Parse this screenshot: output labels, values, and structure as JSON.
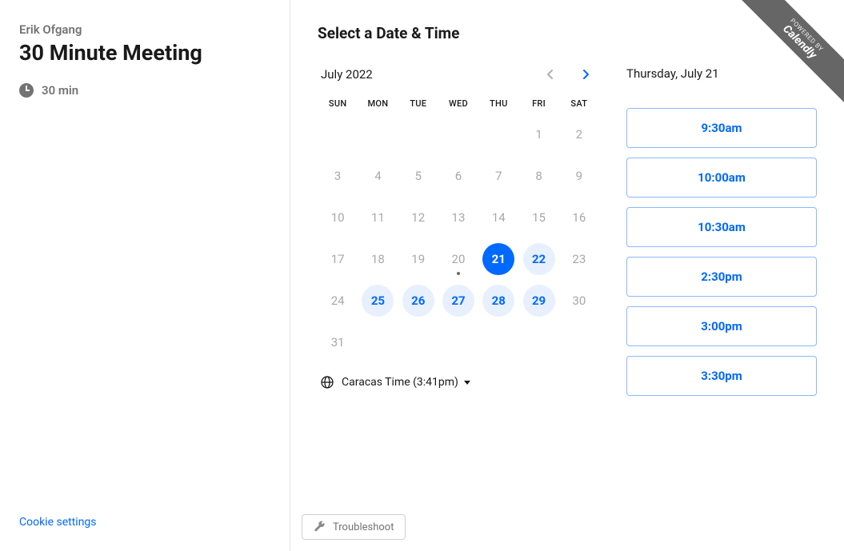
{
  "host": {
    "name": "Erik Ofgang"
  },
  "meeting": {
    "title": "30 Minute Meeting",
    "duration": "30 min"
  },
  "links": {
    "cookie_settings": "Cookie settings"
  },
  "page": {
    "title": "Select a Date & Time"
  },
  "calendar": {
    "month_label": "July 2022",
    "dow": [
      "SUN",
      "MON",
      "TUE",
      "WED",
      "THU",
      "FRI",
      "SAT"
    ],
    "weeks": [
      [
        null,
        null,
        null,
        null,
        null,
        {
          "d": 1
        },
        {
          "d": 2
        }
      ],
      [
        {
          "d": 3
        },
        {
          "d": 4
        },
        {
          "d": 5
        },
        {
          "d": 6
        },
        {
          "d": 7
        },
        {
          "d": 8
        },
        {
          "d": 9
        }
      ],
      [
        {
          "d": 10
        },
        {
          "d": 11
        },
        {
          "d": 12
        },
        {
          "d": 13
        },
        {
          "d": 14
        },
        {
          "d": 15
        },
        {
          "d": 16
        }
      ],
      [
        {
          "d": 17
        },
        {
          "d": 18
        },
        {
          "d": 19
        },
        {
          "d": 20,
          "today": true
        },
        {
          "d": 21,
          "selected": true
        },
        {
          "d": 22,
          "available": true
        },
        {
          "d": 23
        }
      ],
      [
        {
          "d": 24
        },
        {
          "d": 25,
          "available": true
        },
        {
          "d": 26,
          "available": true
        },
        {
          "d": 27,
          "available": true
        },
        {
          "d": 28,
          "available": true
        },
        {
          "d": 29,
          "available": true
        },
        {
          "d": 30
        }
      ],
      [
        {
          "d": 31
        },
        null,
        null,
        null,
        null,
        null,
        null
      ]
    ],
    "timezone_label": "Caracas Time (3:41pm)"
  },
  "selected_date_label": "Thursday, July 21",
  "time_slots": [
    "9:30am",
    "10:00am",
    "10:30am",
    "2:30pm",
    "3:00pm",
    "3:30pm"
  ],
  "footer": {
    "troubleshoot": "Troubleshoot"
  },
  "badge": {
    "top": "POWERED BY",
    "bottom": "Calendly"
  }
}
